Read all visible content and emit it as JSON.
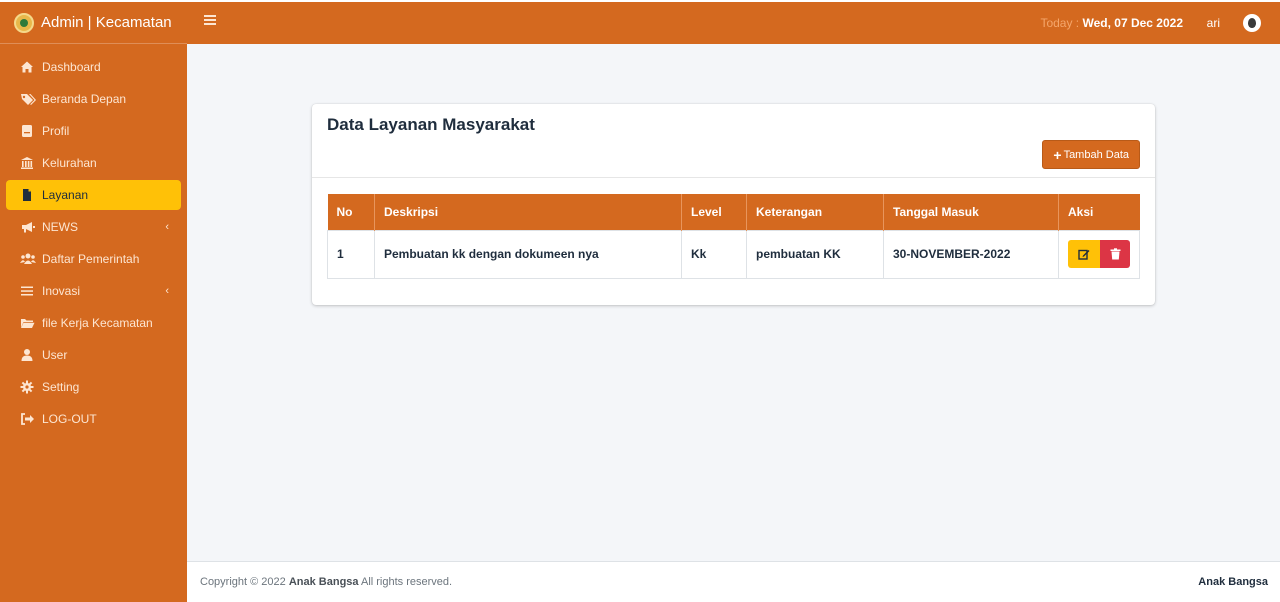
{
  "brand": {
    "title": "Admin | Kecamatan"
  },
  "sidebar": {
    "items": [
      {
        "label": "Dashboard",
        "icon": "home-icon"
      },
      {
        "label": "Beranda Depan",
        "icon": "tags-icon"
      },
      {
        "label": "Profil",
        "icon": "document-icon"
      },
      {
        "label": "Kelurahan",
        "icon": "bank-icon"
      },
      {
        "label": "Layanan",
        "icon": "file-icon",
        "active": true
      },
      {
        "label": "NEWS",
        "icon": "megaphone-icon",
        "arrow": "‹"
      },
      {
        "label": "Daftar Pemerintah",
        "icon": "users-icon"
      },
      {
        "label": "Inovasi",
        "icon": "bars-icon",
        "arrow": "‹"
      },
      {
        "label": "file Kerja Kecamatan",
        "icon": "folder-icon"
      },
      {
        "label": "User",
        "icon": "user-icon"
      },
      {
        "label": "Setting",
        "icon": "gear-icon"
      },
      {
        "label": "LOG-OUT",
        "icon": "sign-out-icon"
      }
    ]
  },
  "topbar": {
    "today_label": "Today : ",
    "today_value": "Wed, 07 Dec 2022",
    "username": "ari"
  },
  "card": {
    "title": "Data Layanan Masyarakat",
    "add_button": "Tambah Data",
    "add_icon": "+"
  },
  "table": {
    "headers": [
      "No",
      "Deskripsi",
      "Level",
      "Keterangan",
      "Tanggal Masuk",
      "Aksi"
    ],
    "rows": [
      {
        "no": "1",
        "deskripsi": "Pembuatan kk dengan dokumeen nya",
        "level": "Kk",
        "keterangan": "pembuatan KK",
        "tanggal": "30-NOVEMBER-2022"
      }
    ]
  },
  "footer": {
    "copyright_prefix": "Copyright © 2022 ",
    "copyright_brand": "Anak Bangsa",
    "copyright_suffix": " All rights reserved.",
    "right": "Anak Bangsa"
  },
  "colors": {
    "primary": "#d4691f",
    "active": "#ffc107",
    "danger": "#dc3545",
    "warning": "#ffc107"
  }
}
